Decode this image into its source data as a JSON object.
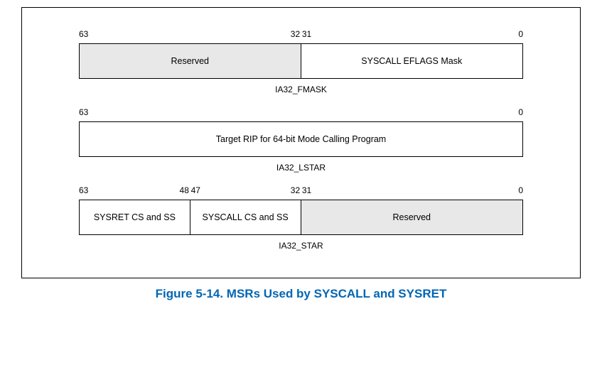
{
  "registers": [
    {
      "name": "IA32_FMASK",
      "bit_labels": {
        "b63": "63",
        "b32": "32",
        "b31": "31",
        "b0": "0"
      },
      "fields": {
        "reserved": "Reserved",
        "eflags_mask": "SYSCALL EFLAGS Mask"
      }
    },
    {
      "name": "IA32_LSTAR",
      "bit_labels": {
        "b63": "63",
        "b0": "0"
      },
      "fields": {
        "target_rip": "Target RIP for 64-bit Mode Calling Program"
      }
    },
    {
      "name": "IA32_STAR",
      "bit_labels": {
        "b63": "63",
        "b48": "48",
        "b47": "47",
        "b32": "32",
        "b31": "31",
        "b0": "0"
      },
      "fields": {
        "sysret_cs_ss": "SYSRET CS and SS",
        "syscall_cs_ss": "SYSCALL CS and SS",
        "reserved": "Reserved"
      }
    }
  ],
  "caption": "Figure 5-14.  MSRs Used by SYSCALL and SYSRET"
}
